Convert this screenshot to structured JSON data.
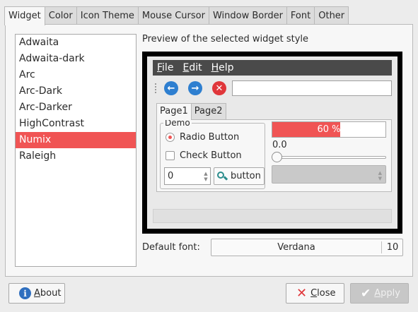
{
  "tabs": [
    "Widget",
    "Color",
    "Icon Theme",
    "Mouse Cursor",
    "Window Border",
    "Font",
    "Other"
  ],
  "active_tab": "Widget",
  "themes": [
    "Adwaita",
    "Adwaita-dark",
    "Arc",
    "Arc-Dark",
    "Arc-Darker",
    "HighContrast",
    "Numix",
    "Raleigh"
  ],
  "selected_theme": "Numix",
  "preview": {
    "label": "Preview of the selected widget style",
    "menu": {
      "file_u": "F",
      "file_rest": "ile",
      "edit_u": "E",
      "edit_rest": "dit",
      "help_u": "H",
      "help_rest": "elp"
    },
    "toolbar_icons": [
      "back-icon",
      "forward-icon",
      "stop-icon"
    ],
    "notebook_tabs": [
      "Page1",
      "Page2"
    ],
    "demo_legend": "Demo",
    "radio_label": "Radio Button",
    "radio_checked": true,
    "check_label": "Check Button",
    "check_checked": false,
    "spin_value": "0",
    "button_label": "button",
    "progress_text": "60 %",
    "progress_value": 0.6,
    "slider_value": "0.0"
  },
  "font": {
    "label": "Default font:",
    "name": "Verdana",
    "size": "10"
  },
  "buttons": {
    "about_u": "A",
    "about_rest": "bout",
    "close_u": "C",
    "close_rest": "lose",
    "apply_u": "A",
    "apply_rest": "pply"
  },
  "colors": {
    "accent": "#f05454",
    "menubar": "#4a4a4a"
  }
}
